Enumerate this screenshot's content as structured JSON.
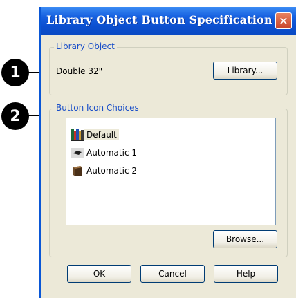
{
  "window": {
    "title": "Library Object Button Specification",
    "close_icon": "close-icon"
  },
  "library_object": {
    "legend": "Library Object",
    "value": "Double 32\"",
    "library_button": "Library..."
  },
  "button_icon_choices": {
    "legend": "Button Icon Choices",
    "items": [
      {
        "label": "Default",
        "icon": "books-icon",
        "selected": true
      },
      {
        "label": "Automatic 1",
        "icon": "automatic-1-icon",
        "selected": false
      },
      {
        "label": "Automatic 2",
        "icon": "automatic-2-icon",
        "selected": false
      }
    ],
    "browse_button": "Browse..."
  },
  "footer": {
    "ok": "OK",
    "cancel": "Cancel",
    "help": "Help"
  },
  "callouts": [
    "1",
    "2"
  ]
}
